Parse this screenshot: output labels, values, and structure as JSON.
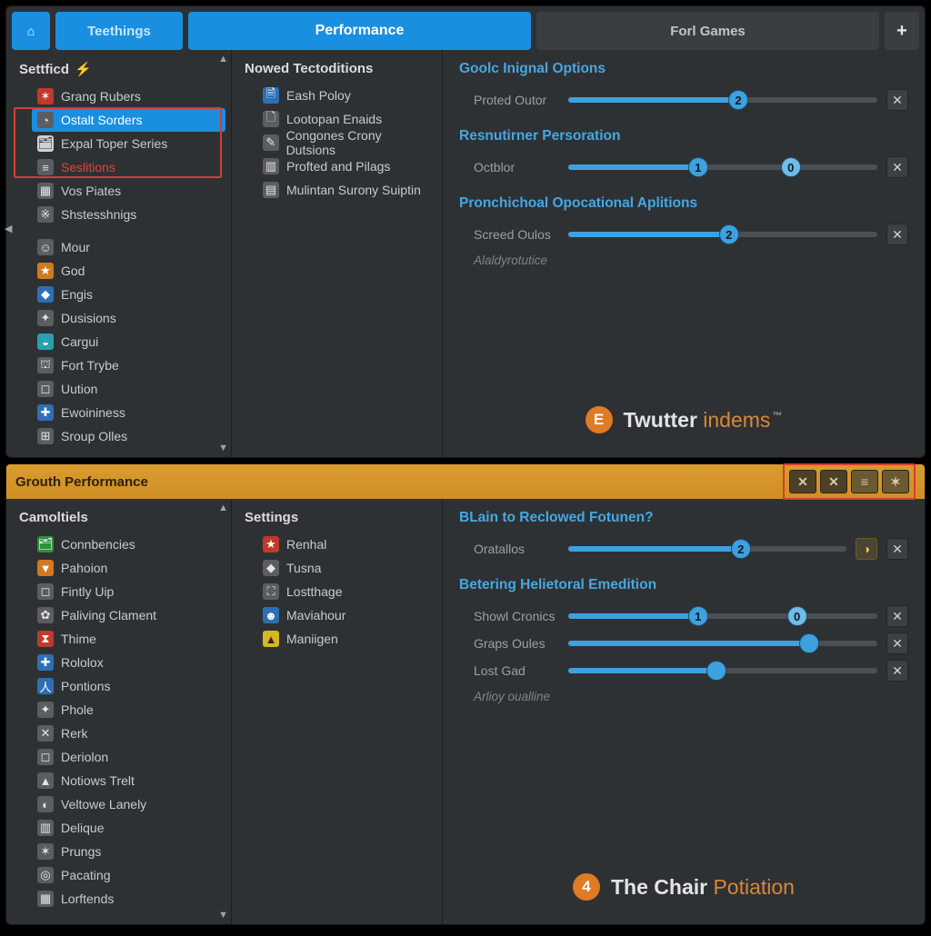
{
  "top": {
    "tabs": {
      "home": "⌂",
      "settings": "Teethings",
      "performance": "Performance",
      "forgames": "Forl Games",
      "add": "+"
    },
    "left": {
      "header": "Settficd",
      "items": [
        {
          "icon": "✶",
          "cls": "ic-red",
          "label": "Grang Rubers"
        },
        {
          "icon": "◔",
          "cls": "ic-gry",
          "label": "Ostalt Sorders",
          "sel": true
        },
        {
          "icon": "🗂",
          "cls": "ic-wht",
          "label": "Expal Toper Series"
        },
        {
          "icon": "≡",
          "cls": "ic-gry",
          "label": "Seslitions",
          "red": true
        },
        {
          "icon": "▦",
          "cls": "ic-gry",
          "label": "Vos Piates"
        },
        {
          "icon": "※",
          "cls": "ic-gry",
          "label": "Shstesshnigs"
        },
        {
          "break": true
        },
        {
          "icon": "☺",
          "cls": "ic-gry",
          "label": "Mour"
        },
        {
          "icon": "★",
          "cls": "ic-org",
          "label": "God"
        },
        {
          "icon": "◆",
          "cls": "ic-blue",
          "label": "Engis"
        },
        {
          "icon": "✦",
          "cls": "ic-gry",
          "label": "Dusisions"
        },
        {
          "icon": "◒",
          "cls": "ic-cyn",
          "label": "Cargui"
        },
        {
          "icon": "⛫",
          "cls": "ic-gry",
          "label": "Fort Trybe"
        },
        {
          "icon": "◻",
          "cls": "ic-gry",
          "label": "Uution"
        },
        {
          "icon": "✚",
          "cls": "ic-blue",
          "label": "Ewoininess"
        },
        {
          "icon": "⊞",
          "cls": "ic-gry",
          "label": "Sroup Olles"
        }
      ]
    },
    "mid": {
      "header": "Nowed Tectoditions",
      "items": [
        {
          "icon": "🗎",
          "cls": "ic-blue",
          "label": "Eash Poloy"
        },
        {
          "icon": "🗋",
          "cls": "ic-gry",
          "label": "Lootopan Enaids"
        },
        {
          "icon": "✎",
          "cls": "ic-gry",
          "label": "Congones Crony Dutsions"
        },
        {
          "icon": "▥",
          "cls": "ic-gry",
          "label": "Profted and Pilags"
        },
        {
          "icon": "▤",
          "cls": "ic-gry",
          "label": "Mulintan Surony Suiptin"
        }
      ]
    },
    "right": {
      "g1": {
        "title": "Goolc Inignal Options",
        "rows": [
          {
            "label": "Proted Outor",
            "fill": 55,
            "knob": 55,
            "val": "2"
          }
        ]
      },
      "g2": {
        "title": "Resnutirner Persoration",
        "rows": [
          {
            "label": "Octblor",
            "fill": 42,
            "knob": 42,
            "val": "1",
            "k2": 72,
            "v2": "0"
          }
        ]
      },
      "g3": {
        "title": "Pronchichoal Opocational Aplitions",
        "rows": [
          {
            "label": "Screed Oulos",
            "fill": 52,
            "knob": 52,
            "val": "2"
          }
        ],
        "sub": "Alaldyrotutice"
      }
    },
    "brand": {
      "letter": "E",
      "a": "Twutter",
      "b": "indems",
      "tm": "™"
    }
  },
  "bottom": {
    "title": "Grouth Performance",
    "winbtns": [
      "✕",
      "✕",
      "≡",
      "✶"
    ],
    "left": {
      "header": "Camoltiels",
      "items": [
        {
          "icon": "🗂",
          "cls": "ic-grn",
          "label": "Connbencies"
        },
        {
          "icon": "▼",
          "cls": "ic-org",
          "label": "Pahoion"
        },
        {
          "icon": "◻",
          "cls": "ic-gry",
          "label": "Fintly Uip"
        },
        {
          "icon": "✿",
          "cls": "ic-gry",
          "label": "Paliving Clament"
        },
        {
          "icon": "⧗",
          "cls": "ic-red",
          "label": "Thime"
        },
        {
          "icon": "✚",
          "cls": "ic-blue",
          "label": "Rololox"
        },
        {
          "icon": "人",
          "cls": "ic-blue",
          "label": "Pontions"
        },
        {
          "icon": "✦",
          "cls": "ic-gry",
          "label": "Phole"
        },
        {
          "icon": "✕",
          "cls": "ic-gry",
          "label": "Rerk"
        },
        {
          "icon": "◻",
          "cls": "ic-gry",
          "label": "Deriolon"
        },
        {
          "icon": "▲",
          "cls": "ic-gry",
          "label": "Notiows Trelt"
        },
        {
          "icon": "◐",
          "cls": "ic-gry",
          "label": "Veltowe Lanely"
        },
        {
          "icon": "▥",
          "cls": "ic-gry",
          "label": "Delique"
        },
        {
          "icon": "✶",
          "cls": "ic-gry",
          "label": "Prungs"
        },
        {
          "icon": "◎",
          "cls": "ic-gry",
          "label": "Pacating"
        },
        {
          "icon": "▦",
          "cls": "ic-gry",
          "label": "Lorftends"
        }
      ]
    },
    "mid": {
      "header": "Settings",
      "items": [
        {
          "icon": "★",
          "cls": "ic-red",
          "label": "Renhal"
        },
        {
          "icon": "◆",
          "cls": "ic-gry",
          "label": "Tusna"
        },
        {
          "icon": "⛶",
          "cls": "ic-gry",
          "label": "Lostthage"
        },
        {
          "icon": "☻",
          "cls": "ic-blue",
          "label": "Maviahour"
        },
        {
          "icon": "▲",
          "cls": "ic-yel",
          "label": "Maniigen"
        }
      ]
    },
    "right": {
      "g1": {
        "title": "BLain to Reclowed Fotunen?",
        "rows": [
          {
            "label": "Oratallos",
            "fill": 62,
            "knob": 62,
            "val": "2",
            "gold": true
          }
        ]
      },
      "g2": {
        "title": "Betering Helietoral Emedition",
        "rows": [
          {
            "label": "Showl Cronics",
            "fill": 42,
            "knob": 42,
            "val": "1",
            "k2": 74,
            "v2": "0"
          },
          {
            "label": "Graps Oules",
            "fill": 78,
            "knob": 78,
            "val": ""
          },
          {
            "label": "Lost Gad",
            "fill": 48,
            "knob": 48,
            "val": ""
          }
        ],
        "sub": "Arlioy oualline"
      }
    },
    "brand": {
      "letter": "4",
      "a": "The Chair",
      "b": "Potiation"
    }
  }
}
